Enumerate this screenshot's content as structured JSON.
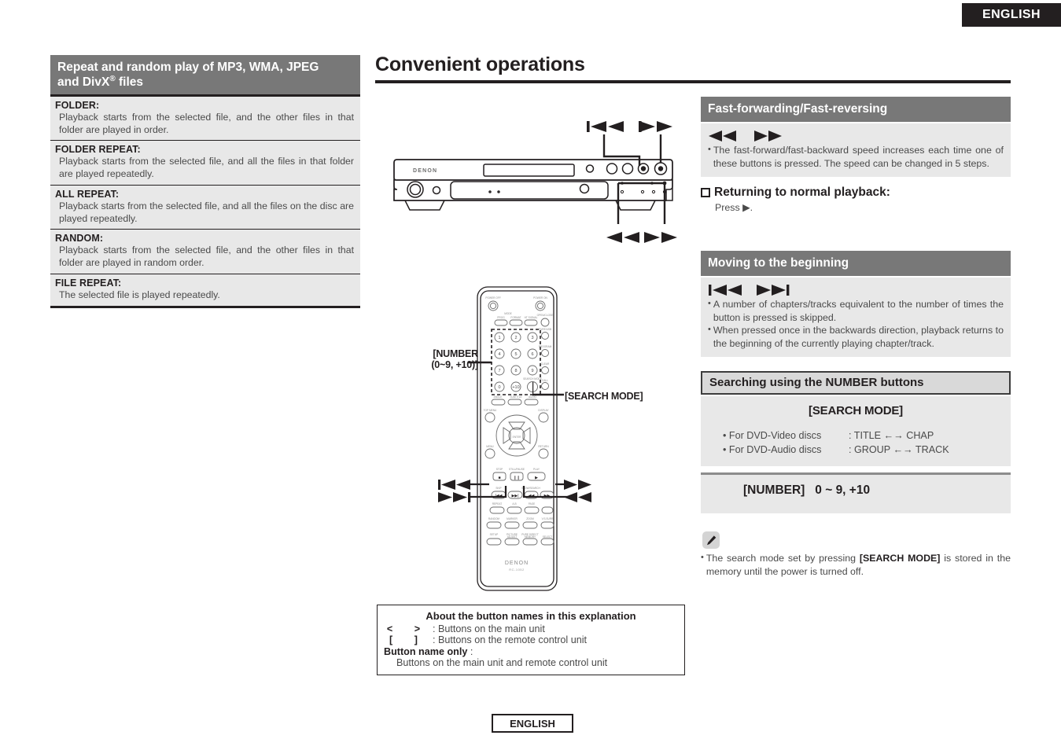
{
  "header": {
    "language_tab": "ENGLISH",
    "footer_language": "ENGLISH"
  },
  "left_column": {
    "section_title": "Repeat and random play of MP3, WMA, JPEG and DivX® files",
    "section_title_line1": "Repeat and random play of MP3, WMA, JPEG",
    "section_title_line2_a": "and DivX",
    "section_title_line2_sup": "®",
    "section_title_line2_b": " files",
    "definitions": [
      {
        "term": "FOLDER:",
        "desc": "Playback starts from the selected file, and the other files in that folder are played in order."
      },
      {
        "term": "FOLDER REPEAT:",
        "desc": "Playback starts from the selected file, and all the files in that folder are played repeatedly."
      },
      {
        "term": "ALL REPEAT:",
        "desc": "Playback starts from the selected file, and all the files on the disc are played repeatedly."
      },
      {
        "term": "RANDOM:",
        "desc": "Playback starts from the selected file, and the other files in that folder are played in random order."
      },
      {
        "term": "FILE REPEAT:",
        "desc": "The selected file is played repeatedly."
      }
    ]
  },
  "center_column": {
    "page_title": "Convenient operations",
    "main_unit": {
      "brand": "DENON",
      "callouts": {
        "skip_prev": "|◀◀",
        "skip_next": "▶▶|",
        "fast_rev": "◀◀",
        "fast_fwd": "▶▶"
      }
    },
    "remote": {
      "brand": "DENON",
      "model": "RC-1052",
      "number_callout_line1": "[NUMBER",
      "number_callout_line2": "(0~9, +10)]",
      "search_mode_callout": "[SEARCH MODE]",
      "keypad_keys": [
        "1",
        "2",
        "3",
        "4",
        "5",
        "6",
        "7",
        "8",
        "9",
        "0",
        "+10"
      ],
      "callouts": {
        "skip_prev": "|◀◀",
        "skip_next": "▶▶|",
        "fast_fwd": "▶▶",
        "fast_rev": "◀◀"
      },
      "key_group_labels": {
        "skip": "SKIP",
        "slow_search": "SLOW/SEARCH",
        "power_off": "POWER OFF",
        "power_on": "POWER ON",
        "stop": "STOP",
        "still_pause": "STILL/PAUSE",
        "play": "PLAY",
        "enter": "ENTER",
        "repeat": "REPEAT",
        "random": "RANDOM",
        "marker": "MARKER",
        "zoom": "ZOOM",
        "search_mode": "SEARCH MODE",
        "clear": "CLEAR",
        "call": "CALL",
        "setup": "SETUP",
        "display": "DISPLAY",
        "menu": "MENU",
        "return": "RETURN",
        "top_menu": "TOP MENU",
        "angle": "ANGLE",
        "subtitle": "SUBTITLE",
        "audio": "AUDIO"
      }
    },
    "about_box": {
      "title": "About the button names in this explanation",
      "rows": [
        {
          "symbol": "< >",
          "text": ": Buttons on the main unit"
        },
        {
          "symbol": "[ ]",
          "text": ": Buttons on the remote control unit"
        }
      ],
      "bold_label": "Button name only",
      "bold_label_colon": ":",
      "bold_label_desc": "Buttons on the main unit and remote control unit"
    }
  },
  "right_column": {
    "sections": [
      {
        "id": "fast-forwarding",
        "heading": "Fast-forwarding/Fast-reversing",
        "arrows": "◀◀    ▶▶",
        "notes": [
          "The fast-forward/fast-backward speed increases each time one of these buttons is pressed. The speed can be changed in 5 steps."
        ],
        "sub_heading": "Returning to normal playback:",
        "sub_text": "Press ▶."
      },
      {
        "id": "moving-to-beginning",
        "heading": "Moving to the beginning",
        "arrows": "|◀◀    ▶▶|",
        "notes": [
          "A number of chapters/tracks equivalent to the number of times the button is pressed is skipped.",
          "When pressed once in the backwards direction, playback returns to the beginning of the currently playing chapter/track."
        ]
      },
      {
        "id": "searching-number",
        "heading": "Searching using the NUMBER buttons",
        "table": {
          "title": "[SEARCH MODE]",
          "rows": [
            {
              "label": "• For DVD-Video discs",
              "value": ": TITLE ←→ CHAP"
            },
            {
              "label": "• For DVD-Audio discs",
              "value": ": GROUP ←→ TRACK"
            }
          ],
          "number_line_bold": "[NUMBER]",
          "number_line_rest": "0 ~ 9, +10"
        }
      }
    ],
    "memo": {
      "icon": "pencil-icon",
      "text_a": "The search mode set by pressing ",
      "text_bold": "[SEARCH MODE]",
      "text_b": " is stored in the memory until the power is turned off."
    }
  },
  "colors": {
    "header_dark": "#787878",
    "header_light_bg": "#d9d9d9",
    "panel_gray": "#e8e8e8",
    "ink": "#231f20",
    "body_text": "#4a4a4a"
  }
}
